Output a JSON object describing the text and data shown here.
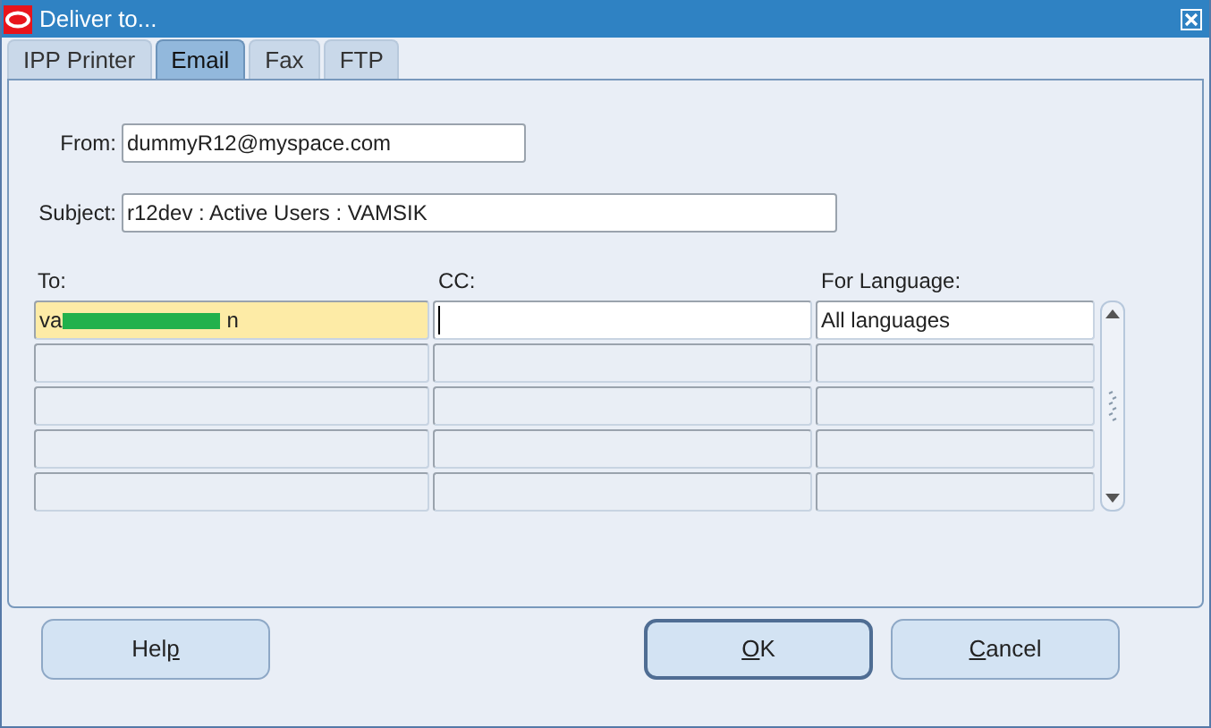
{
  "window": {
    "title": "Deliver to..."
  },
  "tabs": [
    {
      "label": "IPP Printer",
      "selected": false
    },
    {
      "label": "Email",
      "selected": true
    },
    {
      "label": "Fax",
      "selected": false
    },
    {
      "label": "FTP",
      "selected": false
    }
  ],
  "from": {
    "label": "From:",
    "value": "dummyR12@myspace.com"
  },
  "subject": {
    "label": "Subject:",
    "value": "r12dev : Active Users : VAMSIK"
  },
  "columns": [
    "To:",
    "CC:",
    "For Language:"
  ],
  "rows": [
    {
      "to": {
        "value_start": "va",
        "value_end": "n",
        "redacted": true,
        "focused": true
      },
      "cc": {
        "cursor": true
      },
      "language": {
        "value": "All languages"
      },
      "active": true
    },
    {
      "active": false
    },
    {
      "active": false
    },
    {
      "active": false
    },
    {
      "active": false
    }
  ],
  "buttons": [
    {
      "kind": "help",
      "before": "Hel",
      "mnemonic": "p",
      "default": false
    },
    {
      "kind": "ok",
      "mnemonic": "O",
      "after": "K",
      "default": true
    },
    {
      "kind": "cancel",
      "mnemonic": "C",
      "after": "ancel",
      "default": false
    }
  ]
}
